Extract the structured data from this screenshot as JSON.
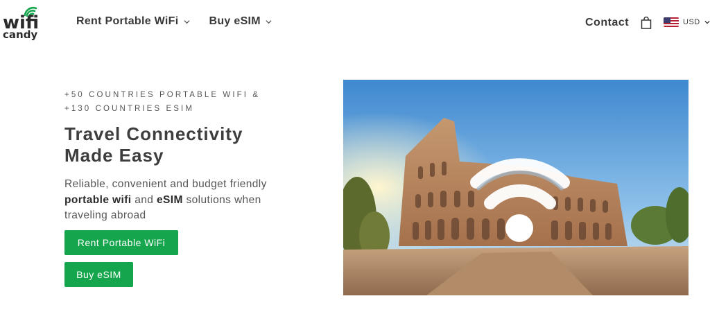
{
  "brand": {
    "logo_line1": "wifi",
    "logo_line2": "candy",
    "accent": "#15a54d"
  },
  "nav": {
    "items": [
      {
        "label": "Rent Portable WiFi",
        "icon": "chevron-down-icon"
      },
      {
        "label": "Buy eSIM",
        "icon": "chevron-down-icon"
      }
    ]
  },
  "header_right": {
    "contact": "Contact",
    "cart_icon": "shopping-bag-icon",
    "currency": "USD",
    "currency_flag": "us-flag-icon"
  },
  "hero": {
    "eyebrow_line1": "+50 COUNTRIES PORTABLE WIFI &",
    "eyebrow_line2": "+130 COUNTRIES ESIM",
    "title_line1": "Travel Connectivity",
    "title_line2": "Made Easy",
    "desc_part1": "Reliable, convenient and budget friendly",
    "desc_bold1": "portable wifi",
    "desc_mid": "and",
    "desc_bold2": "eSIM",
    "desc_part2": "solutions when traveling abroad",
    "btn_wifi": "Rent Portable WiFi",
    "btn_esim": "Buy eSIM",
    "image": "colosseum-with-wifi-icon"
  }
}
